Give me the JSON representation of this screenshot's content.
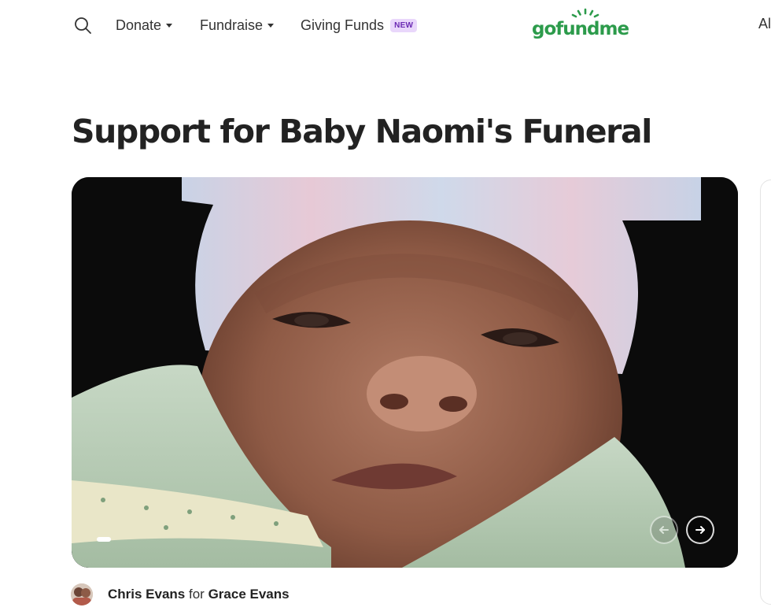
{
  "nav": {
    "search_icon": "search-icon",
    "donate_label": "Donate",
    "fundraise_label": "Fundraise",
    "giving_funds_label": "Giving Funds",
    "giving_funds_badge": "NEW",
    "logo_text": "gofundme",
    "cutoff_text": "Al"
  },
  "campaign": {
    "title": "Support for Baby Naomi's Funeral",
    "organizer": "Chris Evans",
    "for_word": "for",
    "beneficiary": "Grace Evans"
  },
  "carousel": {
    "prev_icon": "arrow-left-icon",
    "next_icon": "arrow-right-icon"
  },
  "colors": {
    "brand_green": "#2c9b4b",
    "badge_bg": "#e9d7fb",
    "badge_text": "#6b2bb3"
  }
}
